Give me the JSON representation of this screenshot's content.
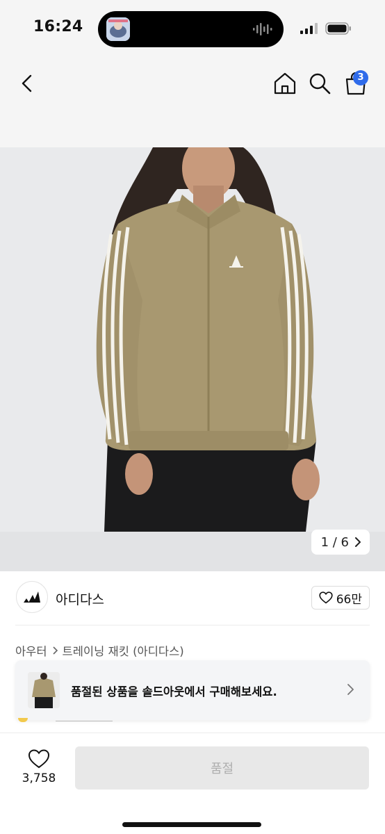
{
  "status_bar": {
    "time": "16:24"
  },
  "nav": {
    "cart_count": "3",
    "icons": [
      "back-chevron-icon",
      "home-icon",
      "search-icon",
      "shopping-bag-icon"
    ]
  },
  "product_image": {
    "counter": "1 / 6"
  },
  "brand": {
    "name": "아디다스"
  },
  "likes": {
    "count": "66만"
  },
  "breadcrumb": {
    "category": "아우터",
    "subcategory": "트레이닝 재킷 (아디다스)"
  },
  "soldout_banner": {
    "text": "품절된 상품을 솔드아웃에서 구매해보세요."
  },
  "bottom_bar": {
    "wish_count": "3,758",
    "buy_label": "품절"
  },
  "colors": {
    "badge": "#2f6bea",
    "jacket": "#a89870",
    "disabled_button": "#e8e8e8"
  }
}
